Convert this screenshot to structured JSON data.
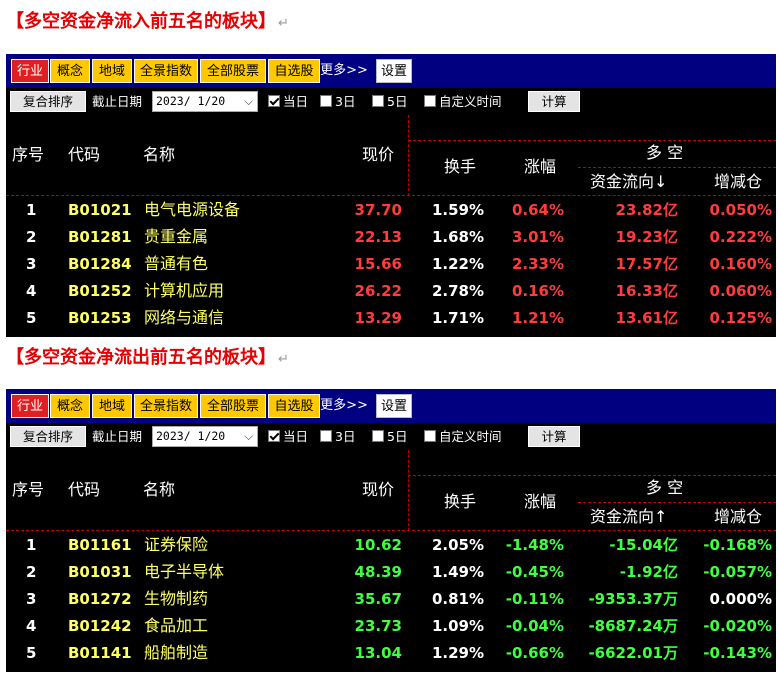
{
  "colors": {
    "up": "#ff3c3c",
    "down": "#40ff40",
    "flat": "#ffffff",
    "code": "#ffff66",
    "tabbar": "#000080"
  },
  "panels": [
    {
      "heading": "【多空资金净流入前五名的板块】",
      "return_mark": "↵",
      "tabs": [
        {
          "label": "行业",
          "active": true
        },
        {
          "label": "概念"
        },
        {
          "label": "地域"
        },
        {
          "label": "全景指数"
        },
        {
          "label": "全部股票"
        },
        {
          "label": "自选股"
        }
      ],
      "more_label": "更多>>",
      "settings_label": "设置",
      "sort_label": "复合排序",
      "date_label": "截止日期",
      "date_value": "2023/ 1/20",
      "options": [
        {
          "label": "当日",
          "checked": true
        },
        {
          "label": "3日",
          "checked": false
        },
        {
          "label": "5日",
          "checked": false
        },
        {
          "label": "自定义时间",
          "checked": false
        }
      ],
      "calc_label": "计算",
      "headers": {
        "seq": "序号",
        "code": "代码",
        "name": "名称",
        "price": "现价",
        "turnover": "换手",
        "change": "涨幅",
        "group": "多 空",
        "flow": "资金流向↓",
        "delta": "增减仓"
      },
      "rows": [
        {
          "seq": "1",
          "code": "B01021",
          "name": "电气电源设备",
          "price": "37.70",
          "turnover": "1.59%",
          "change": "0.64%",
          "flow": "23.82亿",
          "delta": "0.050%",
          "pc": "red",
          "cc": "red",
          "fc": "red",
          "dc": "red"
        },
        {
          "seq": "2",
          "code": "B01281",
          "name": "贵重金属",
          "price": "22.13",
          "turnover": "1.68%",
          "change": "3.01%",
          "flow": "19.23亿",
          "delta": "0.222%",
          "pc": "red",
          "cc": "red",
          "fc": "red",
          "dc": "red"
        },
        {
          "seq": "3",
          "code": "B01284",
          "name": "普通有色",
          "price": "15.66",
          "turnover": "1.22%",
          "change": "2.33%",
          "flow": "17.57亿",
          "delta": "0.160%",
          "pc": "red",
          "cc": "red",
          "fc": "red",
          "dc": "red"
        },
        {
          "seq": "4",
          "code": "B01252",
          "name": "计算机应用",
          "price": "26.22",
          "turnover": "2.78%",
          "change": "0.16%",
          "flow": "16.33亿",
          "delta": "0.060%",
          "pc": "red",
          "cc": "red",
          "fc": "red",
          "dc": "red"
        },
        {
          "seq": "5",
          "code": "B01253",
          "name": "网络与通信",
          "price": "13.29",
          "turnover": "1.71%",
          "change": "1.21%",
          "flow": "13.61亿",
          "delta": "0.125%",
          "pc": "red",
          "cc": "red",
          "fc": "red",
          "dc": "red"
        }
      ]
    },
    {
      "heading": "【多空资金净流出前五名的板块】",
      "return_mark": "↵",
      "tabs": [
        {
          "label": "行业",
          "active": true
        },
        {
          "label": "概念"
        },
        {
          "label": "地域"
        },
        {
          "label": "全景指数"
        },
        {
          "label": "全部股票"
        },
        {
          "label": "自选股"
        }
      ],
      "more_label": "更多>>",
      "settings_label": "设置",
      "sort_label": "复合排序",
      "date_label": "截止日期",
      "date_value": "2023/ 1/20",
      "options": [
        {
          "label": "当日",
          "checked": true
        },
        {
          "label": "3日",
          "checked": false
        },
        {
          "label": "5日",
          "checked": false
        },
        {
          "label": "自定义时间",
          "checked": false
        }
      ],
      "calc_label": "计算",
      "headers": {
        "seq": "序号",
        "code": "代码",
        "name": "名称",
        "price": "现价",
        "turnover": "换手",
        "change": "涨幅",
        "group": "多 空",
        "flow": "资金流向↑",
        "delta": "增减仓"
      },
      "rows": [
        {
          "seq": "1",
          "code": "B01161",
          "name": "证券保险",
          "price": "10.62",
          "turnover": "2.05%",
          "change": "-1.48%",
          "flow": "-15.04亿",
          "delta": "-0.168%",
          "pc": "green",
          "cc": "green",
          "fc": "green",
          "dc": "green"
        },
        {
          "seq": "2",
          "code": "B01031",
          "name": "电子半导体",
          "price": "48.39",
          "turnover": "1.49%",
          "change": "-0.45%",
          "flow": "-1.92亿",
          "delta": "-0.057%",
          "pc": "green",
          "cc": "green",
          "fc": "green",
          "dc": "green"
        },
        {
          "seq": "3",
          "code": "B01272",
          "name": "生物制药",
          "price": "35.67",
          "turnover": "0.81%",
          "change": "-0.11%",
          "flow": "-9353.37万",
          "delta": "0.000%",
          "pc": "green",
          "cc": "green",
          "fc": "green",
          "dc": "plain"
        },
        {
          "seq": "4",
          "code": "B01242",
          "name": "食品加工",
          "price": "23.73",
          "turnover": "1.09%",
          "change": "-0.04%",
          "flow": "-8687.24万",
          "delta": "-0.020%",
          "pc": "green",
          "cc": "green",
          "fc": "green",
          "dc": "green"
        },
        {
          "seq": "5",
          "code": "B01141",
          "name": "船舶制造",
          "price": "13.04",
          "turnover": "1.29%",
          "change": "-0.66%",
          "flow": "-6622.01万",
          "delta": "-0.143%",
          "pc": "green",
          "cc": "green",
          "fc": "green",
          "dc": "green"
        }
      ]
    }
  ]
}
